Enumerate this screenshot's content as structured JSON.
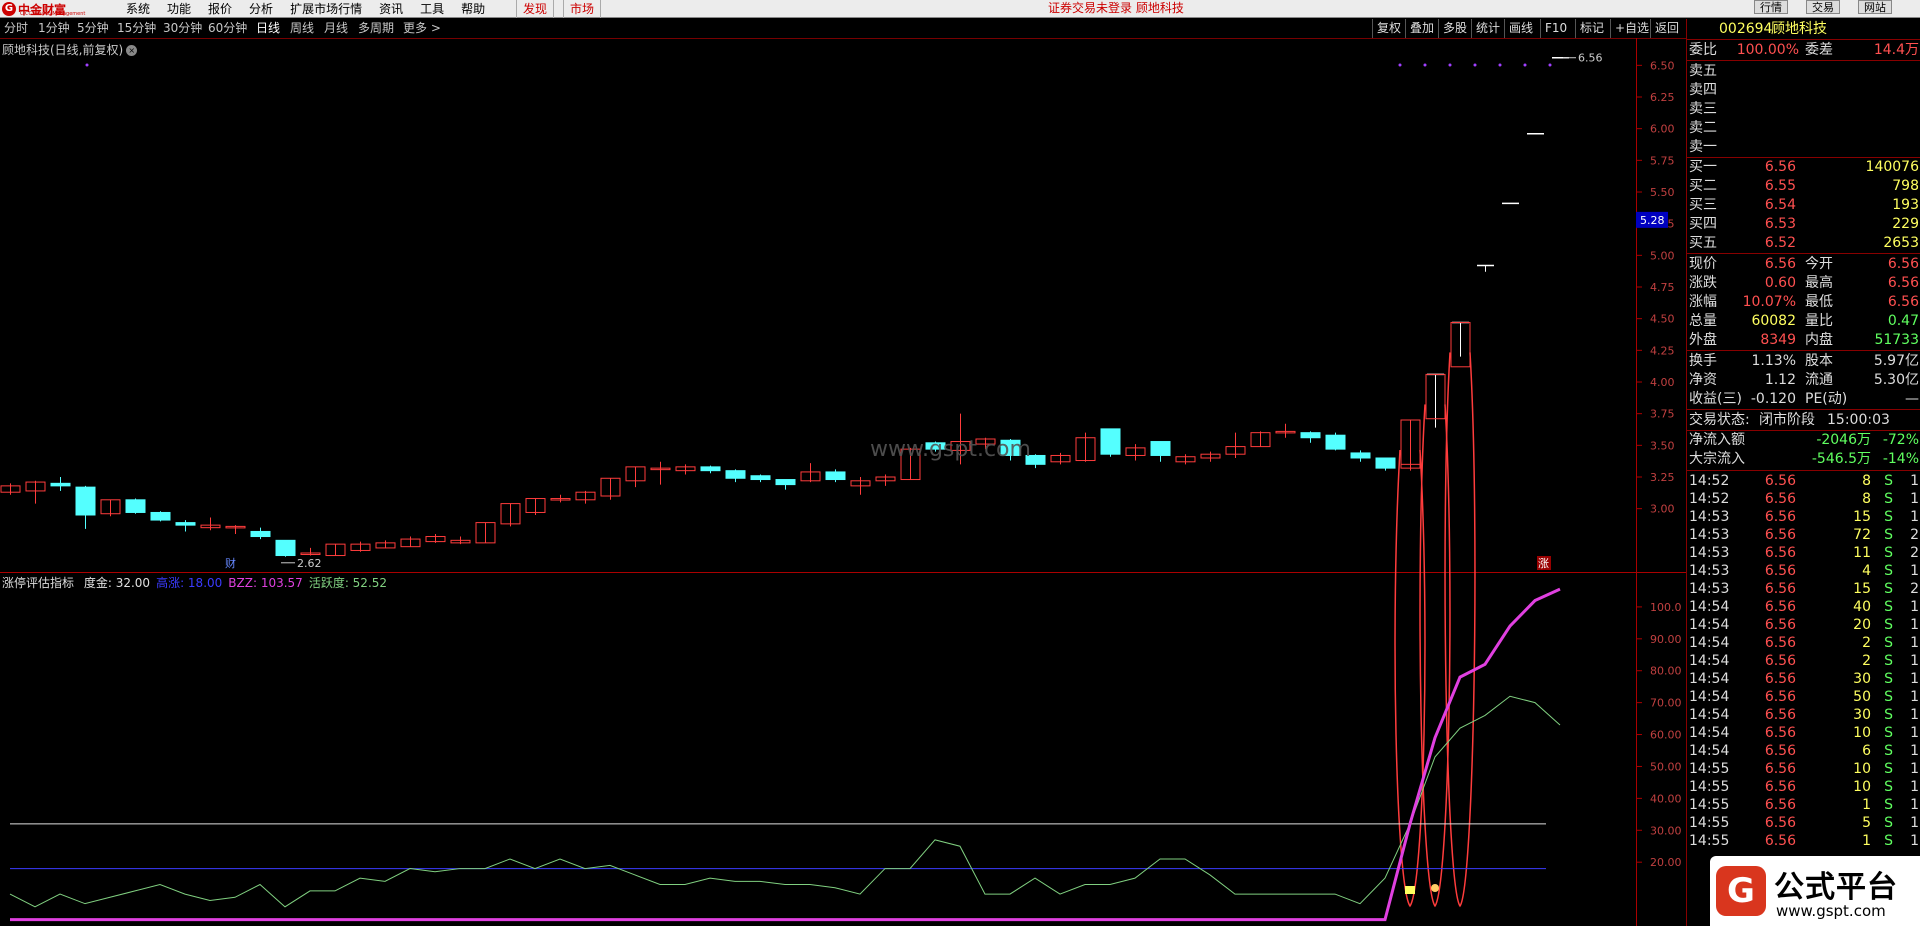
{
  "app": {
    "logo_text": "中金财富",
    "logo_sub": "CICC Wealth Management",
    "menu": [
      "系统",
      "功能",
      "报价",
      "分析",
      "扩展市场行情",
      "资讯",
      "工具",
      "帮助"
    ],
    "btn_discover": "发现",
    "btn_market": "市场",
    "notice": "证券交易未登录 顾地科技",
    "right_buttons": [
      "行情",
      "交易",
      "网站"
    ]
  },
  "periods": [
    "分时",
    "1分钟",
    "5分钟",
    "15分钟",
    "30分钟",
    "60分钟",
    "日线",
    "周线",
    "月线",
    "多周期",
    "更多 >"
  ],
  "toolbar": [
    "复权",
    "叠加",
    "多股",
    "统计",
    "画线",
    "F10",
    "标记",
    "+自选",
    "返回"
  ],
  "chart": {
    "title": "顾地科技(日线,前复权)",
    "price_axis": [
      "6.50",
      "6.25",
      "6.00",
      "5.75",
      "5.50",
      "5.25",
      "5.00",
      "4.75",
      "4.50",
      "4.25",
      "4.00",
      "3.75",
      "3.50",
      "3.25",
      "3.00"
    ],
    "cursor_price": "5.28",
    "high_label": "6.56",
    "low_label": "2.62",
    "cai_label": "财",
    "zhang_label": "涨",
    "watermark": "www.gspt.com"
  },
  "indicator": {
    "name": "涨停评估指标",
    "params": [
      {
        "label": "度金: 32.00",
        "color": "#e0e0e0"
      },
      {
        "label": "高涨: 18.00",
        "color": "#3b3bff"
      },
      {
        "label": "BZZ: 103.57",
        "color": "#e040e0"
      },
      {
        "label": "活跃度: 52.52",
        "color": "#80d080"
      }
    ],
    "axis": [
      "100.0",
      "90.00",
      "80.00",
      "70.00",
      "60.00",
      "50.00",
      "40.00",
      "30.00",
      "20.00"
    ],
    "line_gold": 32.0,
    "line_high": 18.0
  },
  "quote": {
    "code": "002694",
    "name": "顾地科技",
    "weibi_label": "委比",
    "weibi": "100.00%",
    "weicha_label": "委差",
    "weicha": "14.4万",
    "sell": [
      {
        "label": "卖五",
        "price": "",
        "vol": ""
      },
      {
        "label": "卖四",
        "price": "",
        "vol": ""
      },
      {
        "label": "卖三",
        "price": "",
        "vol": ""
      },
      {
        "label": "卖二",
        "price": "",
        "vol": ""
      },
      {
        "label": "卖一",
        "price": "",
        "vol": ""
      }
    ],
    "buy": [
      {
        "label": "买一",
        "price": "6.56",
        "vol": "140076"
      },
      {
        "label": "买二",
        "price": "6.55",
        "vol": "798"
      },
      {
        "label": "买三",
        "price": "6.54",
        "vol": "193"
      },
      {
        "label": "买四",
        "price": "6.53",
        "vol": "229"
      },
      {
        "label": "买五",
        "price": "6.52",
        "vol": "2653"
      }
    ],
    "stats": [
      {
        "l1": "现价",
        "v1": "6.56",
        "c1": "#ff5050",
        "l2": "今开",
        "v2": "6.56",
        "c2": "#ff5050"
      },
      {
        "l1": "涨跌",
        "v1": "0.60",
        "c1": "#ff5050",
        "l2": "最高",
        "v2": "6.56",
        "c2": "#ff5050"
      },
      {
        "l1": "涨幅",
        "v1": "10.07%",
        "c1": "#ff5050",
        "l2": "最低",
        "v2": "6.56",
        "c2": "#ff5050"
      },
      {
        "l1": "总量",
        "v1": "60082",
        "c1": "#ffff60",
        "l2": "量比",
        "v2": "0.47",
        "c2": "#60ff60"
      },
      {
        "l1": "外盘",
        "v1": "8349",
        "c1": "#ff5050",
        "l2": "内盘",
        "v2": "51733",
        "c2": "#60ff60"
      }
    ],
    "stats2": [
      {
        "l1": "换手",
        "v1": "1.13%",
        "l2": "股本",
        "v2": "5.97亿"
      },
      {
        "l1": "净资",
        "v1": "1.12",
        "l2": "流通",
        "v2": "5.30亿"
      },
      {
        "l1": "收益(三)",
        "v1": "-0.120",
        "l2": "PE(动)",
        "v2": "—"
      }
    ],
    "status_label": "交易状态:",
    "status_value": "闭市阶段",
    "status_time": "15:00:03",
    "netflow_label": "净流入额",
    "netflow_value": "-2046万",
    "netflow_pct": "-72%",
    "bigflow_label": "大宗流入",
    "bigflow_value": "-546.5万",
    "bigflow_pct": "-14%",
    "ticks": [
      {
        "t": "14:52",
        "p": "6.56",
        "v": "8",
        "s": "S",
        "n": "1"
      },
      {
        "t": "14:52",
        "p": "6.56",
        "v": "8",
        "s": "S",
        "n": "1"
      },
      {
        "t": "14:53",
        "p": "6.56",
        "v": "15",
        "s": "S",
        "n": "1"
      },
      {
        "t": "14:53",
        "p": "6.56",
        "v": "72",
        "s": "S",
        "n": "2"
      },
      {
        "t": "14:53",
        "p": "6.56",
        "v": "11",
        "s": "S",
        "n": "2"
      },
      {
        "t": "14:53",
        "p": "6.56",
        "v": "4",
        "s": "S",
        "n": "1"
      },
      {
        "t": "14:53",
        "p": "6.56",
        "v": "15",
        "s": "S",
        "n": "2"
      },
      {
        "t": "14:54",
        "p": "6.56",
        "v": "40",
        "s": "S",
        "n": "1"
      },
      {
        "t": "14:54",
        "p": "6.56",
        "v": "20",
        "s": "S",
        "n": "1"
      },
      {
        "t": "14:54",
        "p": "6.56",
        "v": "2",
        "s": "S",
        "n": "1"
      },
      {
        "t": "14:54",
        "p": "6.56",
        "v": "2",
        "s": "S",
        "n": "1"
      },
      {
        "t": "14:54",
        "p": "6.56",
        "v": "30",
        "s": "S",
        "n": "1"
      },
      {
        "t": "14:54",
        "p": "6.56",
        "v": "50",
        "s": "S",
        "n": "1"
      },
      {
        "t": "14:54",
        "p": "6.56",
        "v": "30",
        "s": "S",
        "n": "1"
      },
      {
        "t": "14:54",
        "p": "6.56",
        "v": "10",
        "s": "S",
        "n": "1"
      },
      {
        "t": "14:54",
        "p": "6.56",
        "v": "6",
        "s": "S",
        "n": "1"
      },
      {
        "t": "14:55",
        "p": "6.56",
        "v": "10",
        "s": "S",
        "n": "1"
      },
      {
        "t": "14:55",
        "p": "6.56",
        "v": "10",
        "s": "S",
        "n": "1"
      },
      {
        "t": "14:55",
        "p": "6.56",
        "v": "1",
        "s": "S",
        "n": "1"
      },
      {
        "t": "14:55",
        "p": "6.56",
        "v": "5",
        "s": "S",
        "n": "1"
      },
      {
        "t": "14:55",
        "p": "6.56",
        "v": "1",
        "s": "S",
        "n": "1"
      }
    ]
  },
  "corner": {
    "title": "公式平台",
    "url": "www.gspt.com",
    "icon": "G"
  },
  "colors": {
    "up": "#ff3c3c",
    "down": "#54ffff",
    "bzz": "#e040e0",
    "active": "#80d080"
  },
  "chart_data": {
    "type": "candlestick",
    "price_ylim": [
      2.5,
      6.7
    ],
    "candles": [
      {
        "o": 3.13,
        "c": 3.18,
        "h": 3.2,
        "l": 3.11
      },
      {
        "o": 3.14,
        "c": 3.21,
        "h": 3.22,
        "l": 3.04
      },
      {
        "o": 3.2,
        "c": 3.18,
        "h": 3.25,
        "l": 3.14
      },
      {
        "o": 3.17,
        "c": 2.95,
        "h": 3.18,
        "l": 2.84
      },
      {
        "o": 2.96,
        "c": 3.07,
        "h": 3.07,
        "l": 2.94
      },
      {
        "o": 3.07,
        "c": 2.97,
        "h": 3.08,
        "l": 2.96
      },
      {
        "o": 2.97,
        "c": 2.91,
        "h": 2.98,
        "l": 2.9
      },
      {
        "o": 2.89,
        "c": 2.87,
        "h": 2.91,
        "l": 2.82
      },
      {
        "o": 2.85,
        "c": 2.87,
        "h": 2.93,
        "l": 2.83
      },
      {
        "o": 2.86,
        "c": 2.86,
        "h": 2.87,
        "l": 2.8
      },
      {
        "o": 2.82,
        "c": 2.78,
        "h": 2.85,
        "l": 2.76
      },
      {
        "o": 2.75,
        "c": 2.63,
        "h": 2.75,
        "l": 2.62
      },
      {
        "o": 2.64,
        "c": 2.65,
        "h": 2.69,
        "l": 2.63
      },
      {
        "o": 2.63,
        "c": 2.72,
        "h": 2.72,
        "l": 2.63
      },
      {
        "o": 2.67,
        "c": 2.72,
        "h": 2.74,
        "l": 2.66
      },
      {
        "o": 2.69,
        "c": 2.73,
        "h": 2.75,
        "l": 2.69
      },
      {
        "o": 2.7,
        "c": 2.76,
        "h": 2.78,
        "l": 2.7
      },
      {
        "o": 2.74,
        "c": 2.78,
        "h": 2.8,
        "l": 2.73
      },
      {
        "o": 2.73,
        "c": 2.75,
        "h": 2.78,
        "l": 2.72
      },
      {
        "o": 2.73,
        "c": 2.89,
        "h": 2.89,
        "l": 2.73
      },
      {
        "o": 2.88,
        "c": 3.04,
        "h": 3.04,
        "l": 2.86
      },
      {
        "o": 2.97,
        "c": 3.08,
        "h": 3.08,
        "l": 2.95
      },
      {
        "o": 3.07,
        "c": 3.08,
        "h": 3.11,
        "l": 3.05
      },
      {
        "o": 3.07,
        "c": 3.13,
        "h": 3.14,
        "l": 3.04
      },
      {
        "o": 3.1,
        "c": 3.24,
        "h": 3.24,
        "l": 3.07
      },
      {
        "o": 3.22,
        "c": 3.33,
        "h": 3.33,
        "l": 3.17
      },
      {
        "o": 3.32,
        "c": 3.32,
        "h": 3.37,
        "l": 3.19
      },
      {
        "o": 3.3,
        "c": 3.33,
        "h": 3.35,
        "l": 3.27
      },
      {
        "o": 3.33,
        "c": 3.3,
        "h": 3.34,
        "l": 3.28
      },
      {
        "o": 3.3,
        "c": 3.24,
        "h": 3.31,
        "l": 3.21
      },
      {
        "o": 3.26,
        "c": 3.23,
        "h": 3.27,
        "l": 3.21
      },
      {
        "o": 3.23,
        "c": 3.19,
        "h": 3.23,
        "l": 3.15
      },
      {
        "o": 3.22,
        "c": 3.29,
        "h": 3.36,
        "l": 3.21
      },
      {
        "o": 3.29,
        "c": 3.23,
        "h": 3.31,
        "l": 3.21
      },
      {
        "o": 3.18,
        "c": 3.22,
        "h": 3.25,
        "l": 3.11
      },
      {
        "o": 3.22,
        "c": 3.25,
        "h": 3.27,
        "l": 3.18
      },
      {
        "o": 3.23,
        "c": 3.47,
        "h": 3.48,
        "l": 3.23
      },
      {
        "o": 3.52,
        "c": 3.47,
        "h": 3.53,
        "l": 3.45
      },
      {
        "o": 3.46,
        "c": 3.53,
        "h": 3.75,
        "l": 3.35
      },
      {
        "o": 3.51,
        "c": 3.55,
        "h": 3.56,
        "l": 3.47
      },
      {
        "o": 3.54,
        "c": 3.42,
        "h": 3.55,
        "l": 3.38
      },
      {
        "o": 3.42,
        "c": 3.35,
        "h": 3.43,
        "l": 3.32
      },
      {
        "o": 3.37,
        "c": 3.42,
        "h": 3.44,
        "l": 3.35
      },
      {
        "o": 3.38,
        "c": 3.56,
        "h": 3.6,
        "l": 3.37
      },
      {
        "o": 3.63,
        "c": 3.43,
        "h": 3.63,
        "l": 3.41
      },
      {
        "o": 3.42,
        "c": 3.48,
        "h": 3.51,
        "l": 3.38
      },
      {
        "o": 3.53,
        "c": 3.42,
        "h": 3.53,
        "l": 3.37
      },
      {
        "o": 3.37,
        "c": 3.41,
        "h": 3.43,
        "l": 3.35
      },
      {
        "o": 3.4,
        "c": 3.43,
        "h": 3.45,
        "l": 3.37
      },
      {
        "o": 3.43,
        "c": 3.49,
        "h": 3.6,
        "l": 3.4
      },
      {
        "o": 3.49,
        "c": 3.6,
        "h": 3.61,
        "l": 3.49
      },
      {
        "o": 3.61,
        "c": 3.61,
        "h": 3.67,
        "l": 3.56
      },
      {
        "o": 3.6,
        "c": 3.56,
        "h": 3.61,
        "l": 3.52
      },
      {
        "o": 3.58,
        "c": 3.47,
        "h": 3.6,
        "l": 3.46
      },
      {
        "o": 3.44,
        "c": 3.4,
        "h": 3.46,
        "l": 3.37
      },
      {
        "o": 3.4,
        "c": 3.32,
        "h": 3.4,
        "l": 3.3
      },
      {
        "o": 3.32,
        "c": 3.7,
        "h": 3.7,
        "l": 3.3
      },
      {
        "o": 3.64,
        "c": 4.06,
        "h": 4.06,
        "l": 3.64
      },
      {
        "o": 4.47,
        "c": 4.47,
        "h": 4.47,
        "l": 4.2
      },
      {
        "o": 4.92,
        "c": 4.92,
        "h": 4.92,
        "l": 4.87
      },
      {
        "o": 5.41,
        "c": 5.41,
        "h": 5.41,
        "l": 5.41
      },
      {
        "o": 5.96,
        "c": 5.96,
        "h": 5.96,
        "l": 5.96
      },
      {
        "o": 6.56,
        "c": 6.56,
        "h": 6.56,
        "l": 6.56
      }
    ],
    "indicator_ylim": [
      0,
      110
    ],
    "bzz": [
      0,
      0,
      0,
      0,
      0,
      0,
      0,
      0,
      0,
      0,
      0,
      0,
      0,
      0,
      0,
      0,
      0,
      0,
      0,
      0,
      0,
      0,
      0,
      0,
      0,
      0,
      0,
      0,
      0,
      0,
      0,
      0,
      0,
      0,
      0,
      0,
      0,
      0,
      0,
      0,
      0,
      0,
      0,
      0,
      0,
      0,
      0,
      0,
      0,
      0,
      0,
      0,
      0,
      0,
      0,
      0,
      30,
      57,
      76,
      80,
      92,
      100,
      103.57
    ],
    "active": [
      0,
      -4,
      0,
      -3,
      -1,
      1,
      3,
      0,
      -2,
      -1,
      3,
      -4,
      1,
      1,
      5,
      4,
      8,
      7,
      8,
      8,
      11,
      8,
      11,
      8,
      9,
      6,
      3,
      3,
      5,
      4,
      4,
      3,
      3,
      2,
      0,
      8,
      8,
      17,
      15,
      0,
      0,
      5,
      0,
      3,
      3,
      5,
      11,
      11,
      6,
      0,
      0,
      0,
      0,
      0,
      -3,
      5,
      22,
      43,
      52,
      56,
      62,
      60,
      53
    ],
    "spikes": [
      {
        "i": 56,
        "top": 3.7
      },
      {
        "i": 57,
        "top": 4.06
      },
      {
        "i": 58,
        "top": 4.47
      }
    ]
  }
}
